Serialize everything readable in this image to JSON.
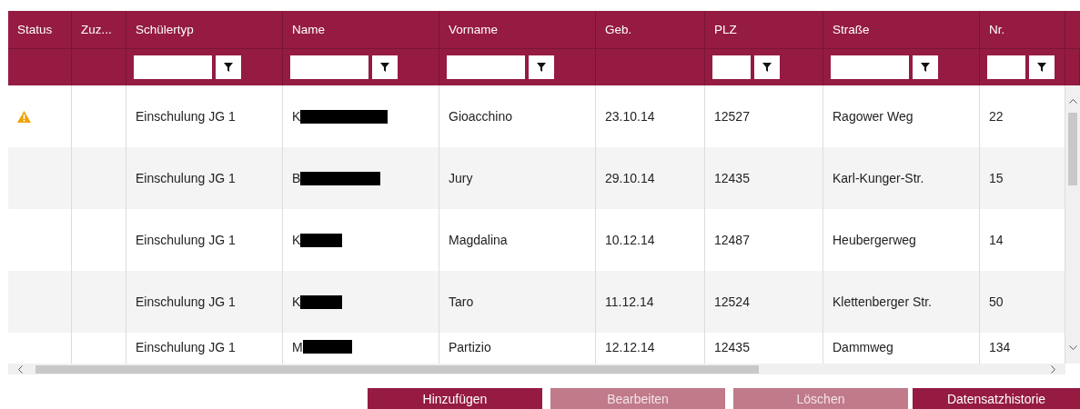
{
  "table": {
    "columns": [
      {
        "label": "Status",
        "filter": false
      },
      {
        "label": "Zuz...",
        "filter": false
      },
      {
        "label": "Schülertyp",
        "filter": true
      },
      {
        "label": "Name",
        "filter": true
      },
      {
        "label": "Vorname",
        "filter": true
      },
      {
        "label": "Geb.",
        "filter": false
      },
      {
        "label": "PLZ",
        "filter": true
      },
      {
        "label": "Straße",
        "filter": true
      },
      {
        "label": "Nr.",
        "filter": true
      }
    ],
    "rows": [
      {
        "warning": true,
        "cells": [
          "",
          "",
          "Einschulung JG 1",
          "K",
          "Gioacchino",
          "23.10.14",
          "12527",
          "Ragower Weg",
          "22"
        ]
      },
      {
        "warning": false,
        "cells": [
          "",
          "",
          "Einschulung JG 1",
          "B",
          "Jury",
          "29.10.14",
          "12435",
          "Karl-Kunger-Str.",
          "15"
        ]
      },
      {
        "warning": false,
        "cells": [
          "",
          "",
          "Einschulung JG 1",
          "K",
          "Magdalina",
          "10.12.14",
          "12487",
          "Heubergerweg",
          "14"
        ]
      },
      {
        "warning": false,
        "cells": [
          "",
          "",
          "Einschulung JG 1",
          "K",
          "Taro",
          "11.12.14",
          "12524",
          "Klettenberger Str.",
          "50"
        ]
      },
      {
        "warning": false,
        "cells": [
          "",
          "",
          "Einschulung JG 1",
          "M",
          "Partizio",
          "12.12.14",
          "12435",
          "Dammweg",
          "134"
        ]
      }
    ]
  },
  "buttons": [
    {
      "label": "Hinzufügen",
      "disabled": false
    },
    {
      "label": "Bearbeiten",
      "disabled": true
    },
    {
      "label": "Löschen",
      "disabled": true
    },
    {
      "label": "Datensatzhistorie",
      "disabled": false
    }
  ]
}
